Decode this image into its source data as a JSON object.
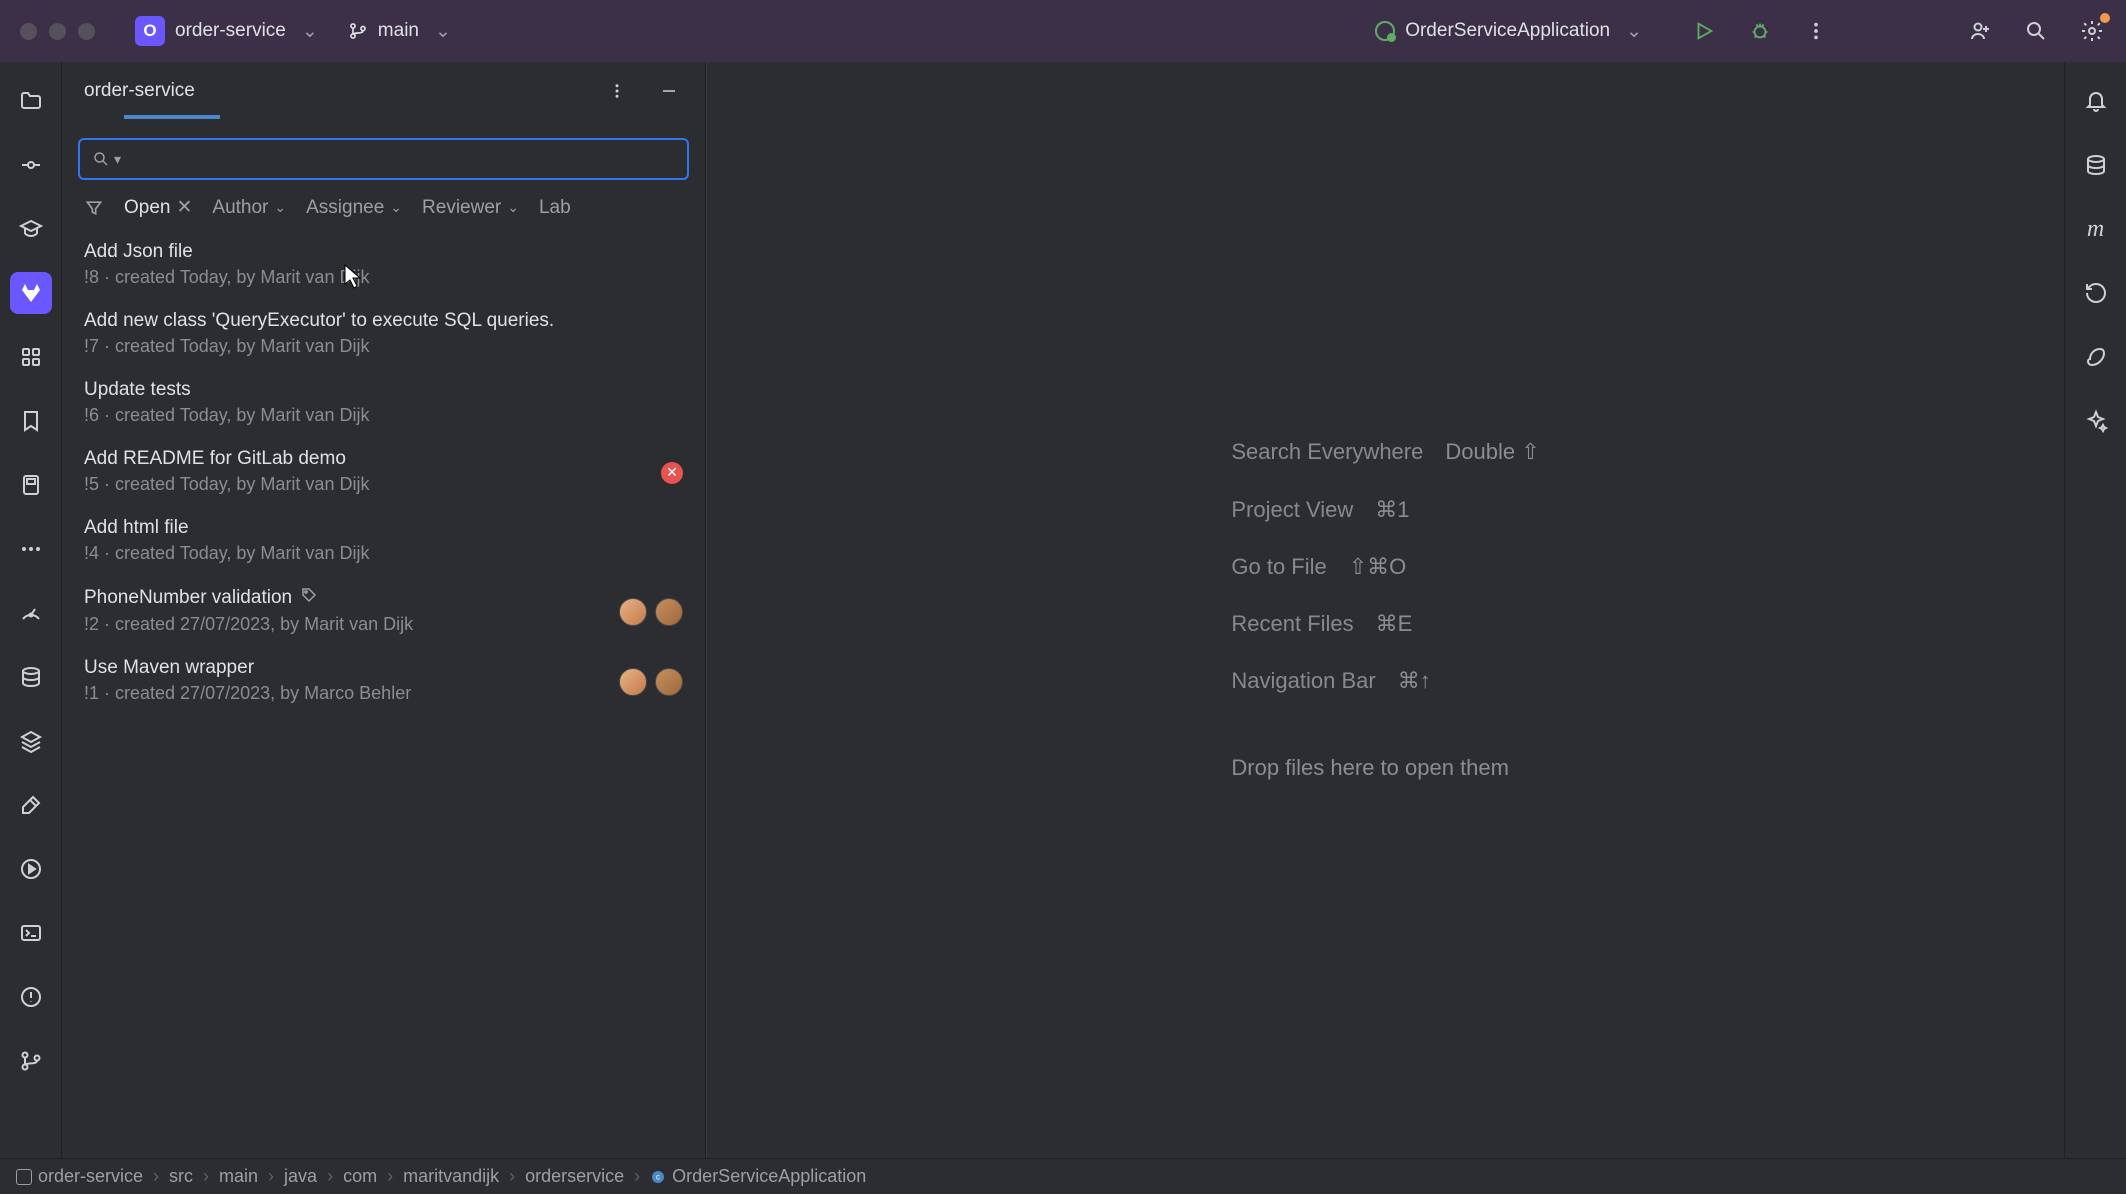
{
  "topbar": {
    "project_letter": "O",
    "project_name": "order-service",
    "branch_name": "main",
    "run_config": "OrderServiceApplication"
  },
  "panel": {
    "title": "order-service",
    "search_placeholder": ""
  },
  "filters": {
    "filter_icon": "filter",
    "open": "Open",
    "author": "Author",
    "assignee": "Assignee",
    "reviewer": "Reviewer",
    "label": "Lab"
  },
  "merge_requests": [
    {
      "title": "Add Json file",
      "id": "!8",
      "meta": "· created Today, by Marit van Dijk",
      "status": null,
      "avatars": 0,
      "tag": false
    },
    {
      "title": "Add new class 'QueryExecutor' to execute SQL queries.",
      "id": "!7",
      "meta": "· created Today, by Marit van Dijk",
      "status": null,
      "avatars": 0,
      "tag": false
    },
    {
      "title": "Update tests",
      "id": "!6",
      "meta": "· created Today, by Marit van Dijk",
      "status": null,
      "avatars": 0,
      "tag": false
    },
    {
      "title": "Add README for GitLab demo",
      "id": "!5",
      "meta": "· created Today, by Marit van Dijk",
      "status": "error",
      "avatars": 0,
      "tag": false
    },
    {
      "title": "Add html file",
      "id": "!4",
      "meta": "· created Today, by Marit van Dijk",
      "status": null,
      "avatars": 0,
      "tag": false
    },
    {
      "title": "PhoneNumber validation",
      "id": "!2",
      "meta": "· created 27/07/2023, by Marit van Dijk",
      "status": null,
      "avatars": 2,
      "tag": true
    },
    {
      "title": "Use Maven wrapper",
      "id": "!1",
      "meta": "· created 27/07/2023, by Marco Behler",
      "status": null,
      "avatars": 2,
      "tag": false
    }
  ],
  "hints": {
    "search_everywhere": "Search Everywhere",
    "search_everywhere_key": "Double ⇧",
    "project_view": "Project View",
    "project_view_key": "⌘1",
    "go_to_file": "Go to File",
    "go_to_file_key": "⇧⌘O",
    "recent_files": "Recent Files",
    "recent_files_key": "⌘E",
    "navigation_bar": "Navigation Bar",
    "navigation_bar_key": "⌘↑",
    "drop_text": "Drop files here to open them"
  },
  "breadcrumb": [
    "order-service",
    "src",
    "main",
    "java",
    "com",
    "maritvandijk",
    "orderservice",
    "OrderServiceApplication"
  ]
}
